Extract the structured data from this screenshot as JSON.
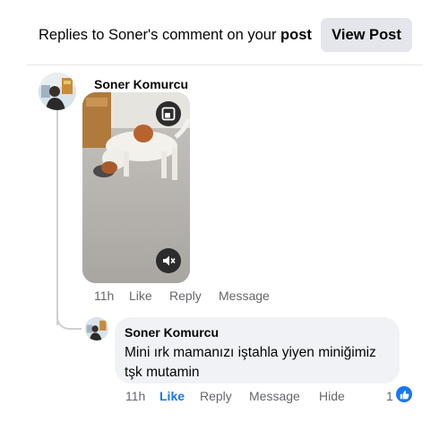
{
  "header": {
    "title_prefix": "Replies to Soner's comment on your ",
    "title_bold": "post",
    "view_post_label": "View Post"
  },
  "comment": {
    "author": "Soner Komurcu",
    "video": {
      "pip_icon": "picture-in-picture-icon",
      "mute_icon": "speaker-muted-icon"
    },
    "actions": {
      "time": "11h",
      "like": "Like",
      "reply": "Reply",
      "message": "Message"
    }
  },
  "reply": {
    "author": "Soner Komurcu",
    "text": "Mini ırk mamanızı iştahla yiyen miniğimiz tşk mutamin",
    "actions": {
      "time": "11h",
      "like": "Like",
      "reply": "Reply",
      "message": "Message",
      "hide": "Hide"
    },
    "reaction_count": "1",
    "reaction_icon": "thumbs-up-icon"
  },
  "colors": {
    "accent": "#1877f2",
    "secondary_text": "#65676b",
    "bubble": "#f0f2f5",
    "button_bg": "#e4e6eb"
  }
}
